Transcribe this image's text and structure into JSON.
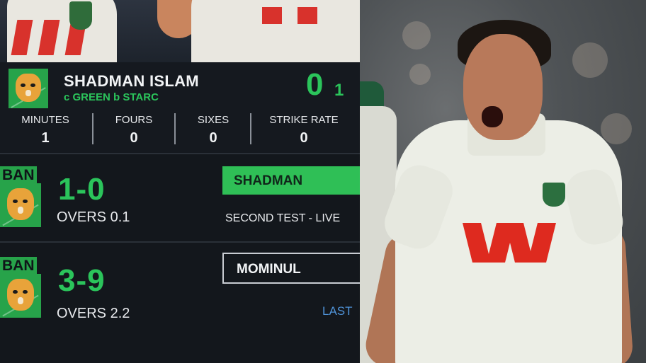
{
  "batter": {
    "name": "SHADMAN ISLAM",
    "dismissal": "c GREEN b STARC",
    "runs": "0",
    "balls": "1",
    "stats": [
      {
        "label": "MINUTES",
        "value": "1"
      },
      {
        "label": "FOURS",
        "value": "0"
      },
      {
        "label": "SIXES",
        "value": "0"
      },
      {
        "label": "STRIKE RATE",
        "value": "0"
      }
    ]
  },
  "scoreboards": [
    {
      "team": "BAN",
      "score": "1-0",
      "overs": "OVERS 0.1",
      "batter_label": "SHADMAN",
      "info": "SECOND TEST  -  LIVE"
    },
    {
      "team": "BAN",
      "score": "3-9",
      "overs": "OVERS 2.2",
      "batter_label": "MOMINUL",
      "info": "LAST"
    }
  ],
  "colors": {
    "accent_green": "#2bc45b",
    "panel_bg": "#13171c",
    "link_blue": "#4f93d8",
    "sponsor_red": "#de2a1f"
  }
}
